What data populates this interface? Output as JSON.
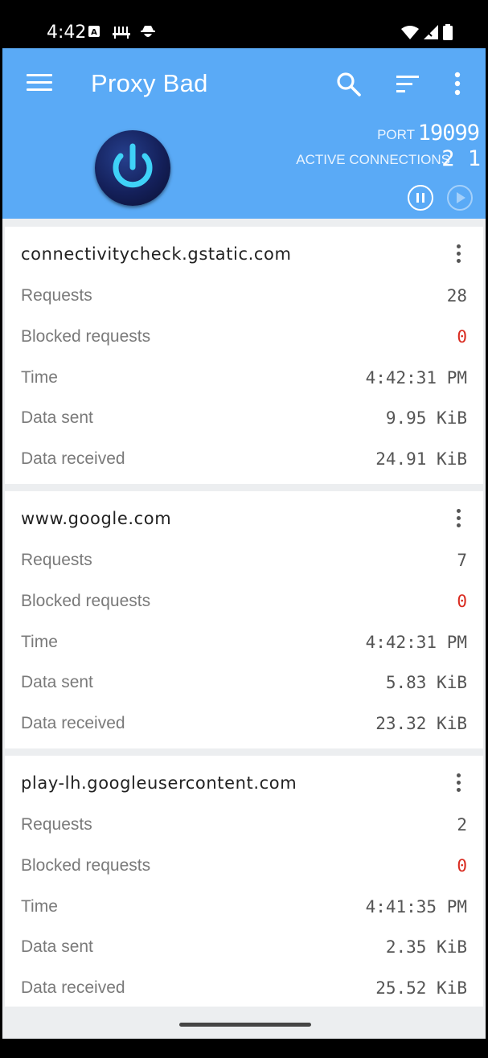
{
  "status_bar": {
    "time": "4:42",
    "icons": [
      "a-notification-icon",
      "network-icon",
      "incognito-icon",
      "wifi-icon",
      "signal-icon",
      "battery-icon"
    ]
  },
  "header": {
    "title": "Proxy Bad",
    "port_label": "PORT",
    "port_value": "19099",
    "connections_label": "ACTIVE CONNECTIONS",
    "connections_value": "2 1",
    "accent_color": "#5aaaf6"
  },
  "labels": {
    "requests": "Requests",
    "blocked": "Blocked requests",
    "time": "Time",
    "sent": "Data sent",
    "received": "Data received"
  },
  "cards": [
    {
      "host": "connectivitycheck.gstatic.com",
      "requests": "28",
      "blocked": "0",
      "time": "4:42:31 PM",
      "sent": "9.95 KiB",
      "received": "24.91 KiB"
    },
    {
      "host": "www.google.com",
      "requests": "7",
      "blocked": "0",
      "time": "4:42:31 PM",
      "sent": "5.83 KiB",
      "received": "23.32 KiB"
    },
    {
      "host": "play-lh.googleusercontent.com",
      "requests": "2",
      "blocked": "0",
      "time": "4:41:35 PM",
      "sent": "2.35 KiB",
      "received": "25.52 KiB"
    }
  ]
}
